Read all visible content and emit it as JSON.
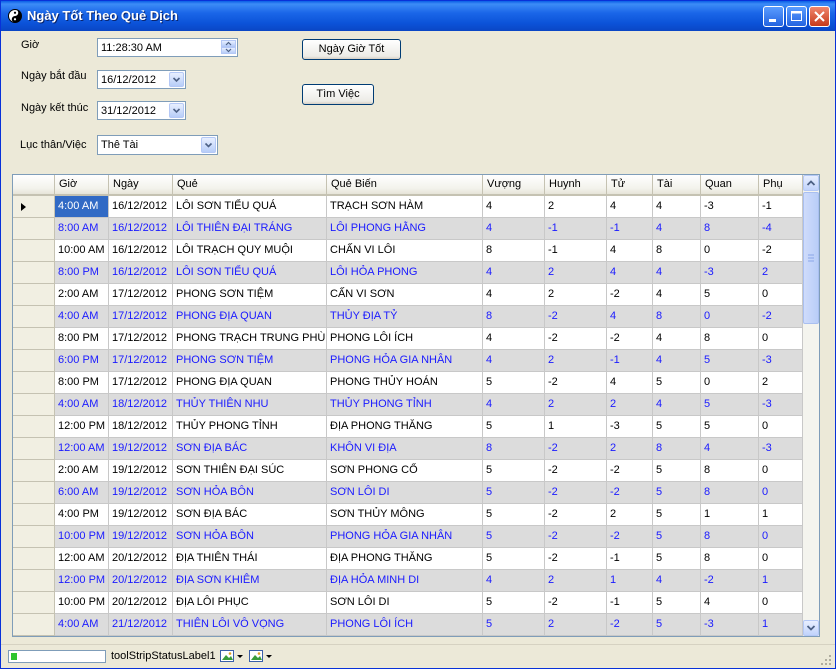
{
  "window": {
    "title": "Ngày Tốt Theo Quẻ Dịch"
  },
  "form": {
    "gio_label": "Giờ",
    "gio_value": "11:28:30 AM",
    "ngay_bat_dau_label": "Ngày bắt đầu",
    "ngay_bat_dau_value": "16/12/2012",
    "ngay_ket_thuc_label": "Ngày kết thúc",
    "ngay_ket_thuc_value": "31/12/2012",
    "luc_than_label": "Lục thân/Việc",
    "luc_than_value": "Thê Tài",
    "btn_ngay_gio_tot": "Ngày Giờ Tốt",
    "btn_tim_viec": "Tìm Việc"
  },
  "grid": {
    "columns": [
      "Giờ",
      "Ngày",
      "Quẻ",
      "Quẻ Biến",
      "Vượng",
      "Huynh",
      "Tử",
      "Tài",
      "Quan",
      "Phụ"
    ],
    "rows": [
      [
        "4:00 AM",
        "16/12/2012",
        "LÔI SƠN TIỂU QUÁ",
        "TRẠCH SƠN HÀM",
        "4",
        "2",
        "4",
        "4",
        "-3",
        "-1"
      ],
      [
        "8:00 AM",
        "16/12/2012",
        "LÔI THIÊN ĐẠI TRÁNG",
        "LÔI PHONG HẰNG",
        "4",
        "-1",
        "-1",
        "4",
        "8",
        "-4"
      ],
      [
        "10:00 AM",
        "16/12/2012",
        "LÔI TRẠCH QUY MUỘI",
        "CHẤN VI LÔI",
        "8",
        "-1",
        "4",
        "8",
        "0",
        "-2"
      ],
      [
        "8:00 PM",
        "16/12/2012",
        "LÔI SƠN TIỂU QUÁ",
        "LÔI HỎA PHONG",
        "4",
        "2",
        "4",
        "4",
        "-3",
        "2"
      ],
      [
        "2:00 AM",
        "17/12/2012",
        "PHONG SƠN TIỆM",
        "CẤN VI SƠN",
        "4",
        "2",
        "-2",
        "4",
        "5",
        "0"
      ],
      [
        "4:00 AM",
        "17/12/2012",
        "PHONG ĐỊA QUAN",
        "THỦY ĐỊA TỶ",
        "8",
        "-2",
        "4",
        "8",
        "0",
        "-2"
      ],
      [
        "8:00 PM",
        "17/12/2012",
        "PHONG TRẠCH TRUNG PHÙ",
        "PHONG LÔI ÍCH",
        "4",
        "-2",
        "-2",
        "4",
        "8",
        "0"
      ],
      [
        "6:00 PM",
        "17/12/2012",
        "PHONG SƠN TIỆM",
        "PHONG HỎA GIA NHÂN",
        "4",
        "2",
        "-1",
        "4",
        "5",
        "-3"
      ],
      [
        "8:00 PM",
        "17/12/2012",
        "PHONG ĐỊA QUAN",
        "PHONG THỦY HOÁN",
        "5",
        "-2",
        "4",
        "5",
        "0",
        "2"
      ],
      [
        "4:00 AM",
        "18/12/2012",
        "THỦY THIÊN NHU",
        "THỦY PHONG TỈNH",
        "4",
        "2",
        "2",
        "4",
        "5",
        "-3"
      ],
      [
        "12:00 PM",
        "18/12/2012",
        "THỦY PHONG TỈNH",
        "ĐỊA PHONG THĂNG",
        "5",
        "1",
        "-3",
        "5",
        "5",
        "0"
      ],
      [
        "12:00 AM",
        "19/12/2012",
        "SƠN ĐỊA BÁC",
        "KHÔN VI ĐỊA",
        "8",
        "-2",
        "2",
        "8",
        "4",
        "-3"
      ],
      [
        "2:00 AM",
        "19/12/2012",
        "SƠN THIÊN ĐẠI SÚC",
        "SƠN PHONG CỔ",
        "5",
        "-2",
        "-2",
        "5",
        "8",
        "0"
      ],
      [
        "6:00 AM",
        "19/12/2012",
        "SƠN HỎA BÔN",
        "SƠN LÔI DI",
        "5",
        "-2",
        "-2",
        "5",
        "8",
        "0"
      ],
      [
        "4:00 PM",
        "19/12/2012",
        "SƠN ĐỊA BÁC",
        "SƠN THỦY MÔNG",
        "5",
        "-2",
        "2",
        "5",
        "1",
        "1"
      ],
      [
        "10:00 PM",
        "19/12/2012",
        "SƠN HỎA BÔN",
        "PHONG HỎA GIA NHÂN",
        "5",
        "-2",
        "-2",
        "5",
        "8",
        "0"
      ],
      [
        "12:00 AM",
        "20/12/2012",
        "ĐỊA THIÊN THÁI",
        "ĐỊA PHONG THĂNG",
        "5",
        "-2",
        "-1",
        "5",
        "8",
        "0"
      ],
      [
        "12:00 PM",
        "20/12/2012",
        "ĐỊA SƠN KHIÊM",
        "ĐỊA HỎA MINH DI",
        "4",
        "2",
        "1",
        "4",
        "-2",
        "1"
      ],
      [
        "10:00 PM",
        "20/12/2012",
        "ĐỊA LÔI PHỤC",
        "SƠN LÔI DI",
        "5",
        "-2",
        "-1",
        "5",
        "4",
        "0"
      ],
      [
        "4:00 AM",
        "21/12/2012",
        "THIÊN LÔI VÔ VỌNG",
        "PHONG LÔI ÍCH",
        "5",
        "2",
        "-2",
        "5",
        "-3",
        "1"
      ]
    ]
  },
  "status": {
    "label": "toolStripStatusLabel1",
    "progress": 0.06
  },
  "colors": {
    "selected": "#316ac5",
    "alt_row_bg": "#dcdcdc",
    "alt_row_text": "#1a1aff"
  }
}
